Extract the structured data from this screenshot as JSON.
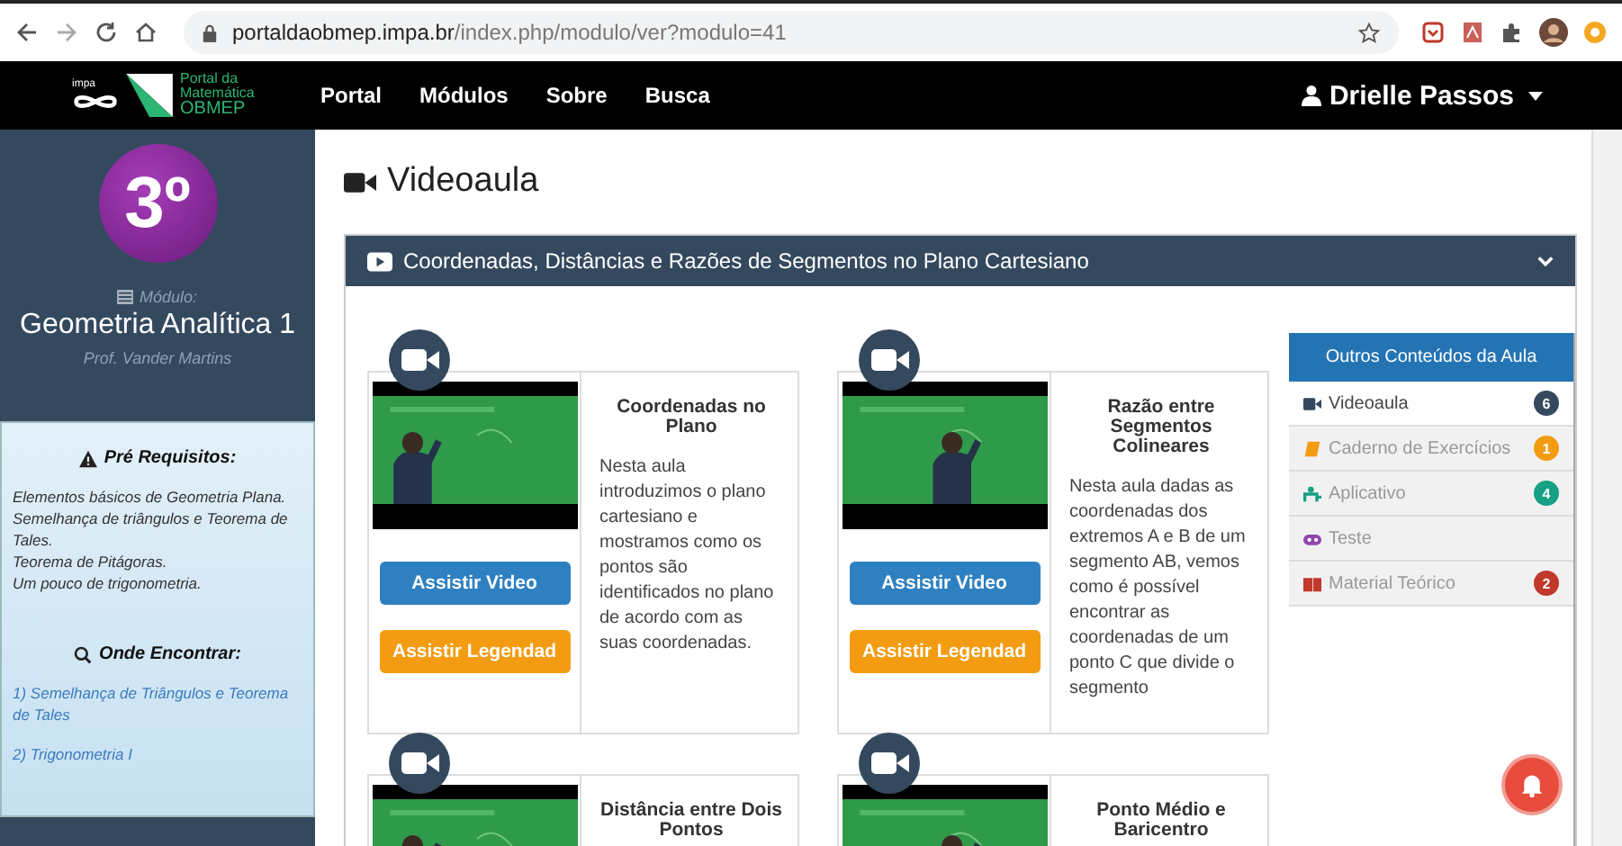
{
  "browser": {
    "url_host": "portaldaobmep.impa.br",
    "url_path": "/index.php/modulo/ver?modulo=41"
  },
  "navbar": {
    "logo_small": "impa",
    "logo_lines": [
      "Portal da",
      "Matemática",
      "OBMEP"
    ],
    "links": [
      "Portal",
      "Módulos",
      "Sobre",
      "Busca"
    ],
    "user": "Drielle Passos"
  },
  "sidebar": {
    "year": "3º",
    "module_label": "Módulo:",
    "module": "Geometria Analítica 1",
    "teacher": "Prof. Vander Martins",
    "prereq_title": "Pré Requisitos:",
    "prereqs": [
      "Elementos básicos de Geometria Plana.",
      "Semelhança de triângulos e Teorema de Tales.",
      "Teorema de Pitágoras.",
      "Um pouco de trigonometria."
    ],
    "where_title": "Onde Encontrar:",
    "where_links": [
      "1) Semelhança de Triângulos e Teorema de Tales",
      "2) Trigonometria I"
    ]
  },
  "page_title": "Videoaula",
  "panel": {
    "title": "Coordenadas, Distâncias e Razões de Segmentos no Plano Cartesiano",
    "cards": [
      {
        "title": "Coordenadas no Plano",
        "description": "Nesta aula introduzimos o plano cartesiano e mostramos como os pontos são identificados no plano de acordo com as suas coordenadas.",
        "buttons": [
          "Assistir Video",
          "Assistir Legendad"
        ]
      },
      {
        "title": "Razão entre Segmentos Colineares",
        "description": "Nesta aula dadas as coordenadas dos extremos A e B de um segmento AB, vemos como é possível encontrar as coordenadas de um ponto C que divide o segmento",
        "buttons": [
          "Assistir Video",
          "Assistir Legendad"
        ]
      },
      {
        "title": "Distância entre Dois Pontos"
      },
      {
        "title": "Ponto Médio e Baricentro"
      }
    ],
    "other": {
      "title": "Outros Conteúdos da Aula",
      "items": [
        {
          "kind": "video",
          "label": "Videoaula",
          "count": "6",
          "color": "#34495e",
          "selected": true
        },
        {
          "kind": "book",
          "label": "Caderno de Exercícios",
          "count": "1",
          "color": "#f39c12",
          "selected": false
        },
        {
          "kind": "app",
          "label": "Aplicativo",
          "count": "4",
          "color": "#16a085",
          "selected": false
        },
        {
          "kind": "test",
          "label": "Teste",
          "color": "#8e44ad",
          "selected": false
        },
        {
          "kind": "material",
          "label": "Material Teórico",
          "count": "2",
          "color": "#c0392b",
          "selected": false
        }
      ]
    }
  }
}
